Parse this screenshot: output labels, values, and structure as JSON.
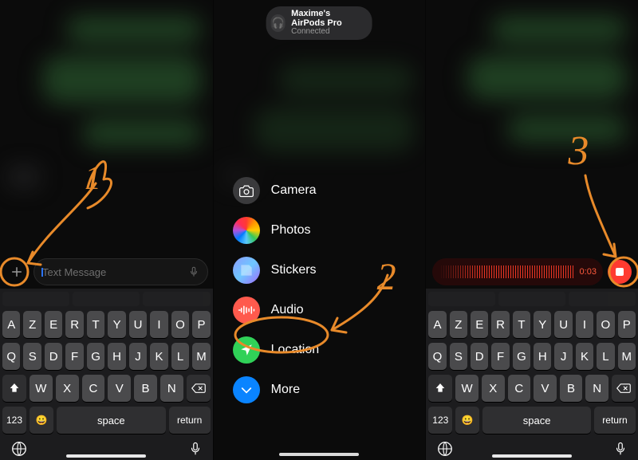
{
  "airpods": {
    "title": "Maxime's AirPods Pro",
    "status": "Connected"
  },
  "compose": {
    "placeholder": "Text Message"
  },
  "menu": {
    "items": [
      {
        "label": "Camera"
      },
      {
        "label": "Photos"
      },
      {
        "label": "Stickers"
      },
      {
        "label": "Audio"
      },
      {
        "label": "Location"
      },
      {
        "label": "More"
      }
    ]
  },
  "recording": {
    "time": "0:03"
  },
  "keyboard": {
    "row1": [
      "A",
      "Z",
      "E",
      "R",
      "T",
      "Y",
      "U",
      "I",
      "O",
      "P"
    ],
    "row2": [
      "Q",
      "S",
      "D",
      "F",
      "G",
      "H",
      "J",
      "K",
      "L",
      "M"
    ],
    "row3": [
      "W",
      "X",
      "C",
      "V",
      "B",
      "N"
    ],
    "numkey": "123",
    "space": "space",
    "return": "return"
  },
  "annotations": {
    "step1": "1",
    "step2": "2",
    "step3": "3"
  }
}
